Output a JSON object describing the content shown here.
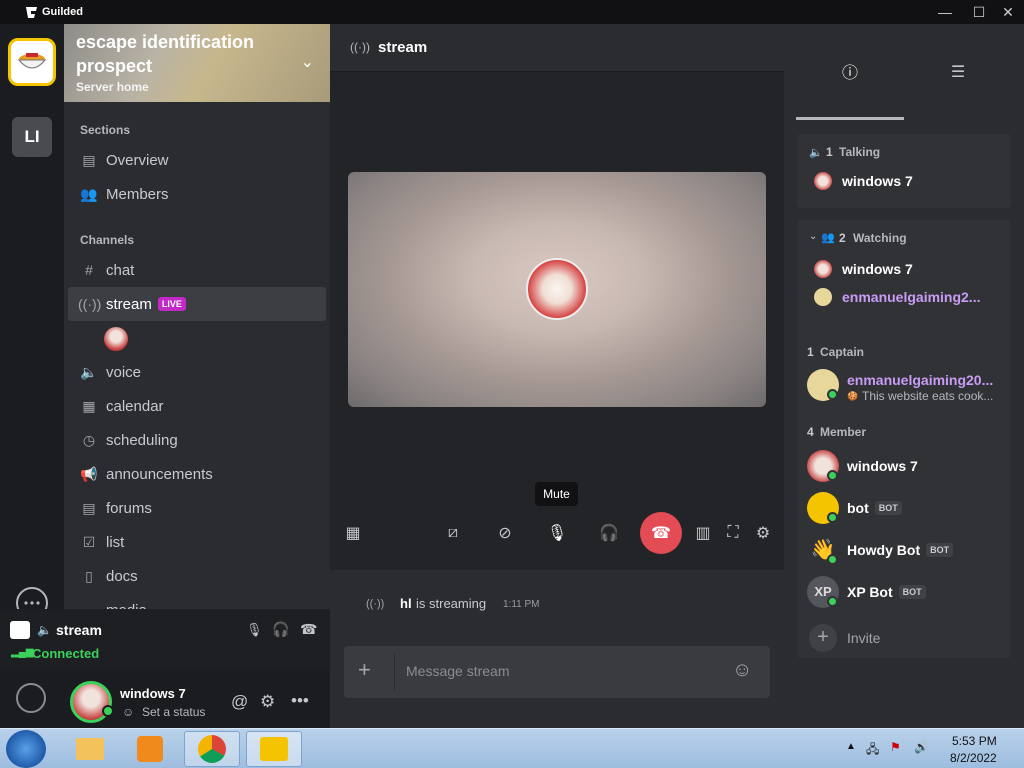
{
  "app": {
    "title": "Guilded"
  },
  "server": {
    "name": "escape identification prospect",
    "subtitle": "Server home",
    "rail_second": "LI"
  },
  "sidebar": {
    "sections_header": "Sections",
    "sections": [
      {
        "label": "Overview",
        "icon": "overview-icon"
      },
      {
        "label": "Members",
        "icon": "members-icon"
      }
    ],
    "channels_header": "Channels",
    "channels": [
      {
        "label": "chat",
        "icon": "hash-icon"
      },
      {
        "label": "stream",
        "icon": "stream-icon",
        "badge": "LIVE"
      },
      {
        "label": "voice",
        "icon": "speaker-icon"
      },
      {
        "label": "calendar",
        "icon": "calendar-icon"
      },
      {
        "label": "scheduling",
        "icon": "clock-icon"
      },
      {
        "label": "announcements",
        "icon": "megaphone-icon"
      },
      {
        "label": "forums",
        "icon": "forums-icon"
      },
      {
        "label": "list",
        "icon": "checkbox-icon"
      },
      {
        "label": "docs",
        "icon": "docs-icon"
      },
      {
        "label": "media",
        "icon": "media-icon"
      }
    ]
  },
  "voice": {
    "channel": "stream",
    "status": "Connected"
  },
  "user": {
    "name": "windows 7",
    "status": "Set a status"
  },
  "channel_header": {
    "title": "stream"
  },
  "stage": {
    "tooltip": "Mute"
  },
  "feed": {
    "author": "hl",
    "text": "is streaming",
    "time": "1:11 PM"
  },
  "composer": {
    "placeholder": "Message stream"
  },
  "right": {
    "talking": {
      "count": "1",
      "label": "Talking",
      "members": [
        "windows 7"
      ]
    },
    "watching": {
      "count": "2",
      "label": "Watching",
      "members": [
        "windows 7",
        "enmanuelgaiming2..."
      ]
    },
    "captain": {
      "count": "1",
      "label": "Captain",
      "name": "enmanuelgaiming20...",
      "status": "This website eats cook..."
    },
    "member": {
      "count": "4",
      "label": "Member",
      "list": [
        {
          "name": "windows 7",
          "bot": ""
        },
        {
          "name": "bot",
          "bot": "BOT"
        },
        {
          "name": "Howdy Bot",
          "bot": "BOT"
        },
        {
          "name": "XP Bot",
          "bot": "BOT"
        }
      ]
    },
    "invite": "Invite"
  },
  "taskbar": {
    "time": "5:53 PM",
    "date": "8/2/2022"
  },
  "colors": {
    "accent": "#f5c400",
    "live": "#c12ac4",
    "connected": "#3bd15b",
    "hangup": "#e34b55",
    "captain": "#c99cf5"
  }
}
